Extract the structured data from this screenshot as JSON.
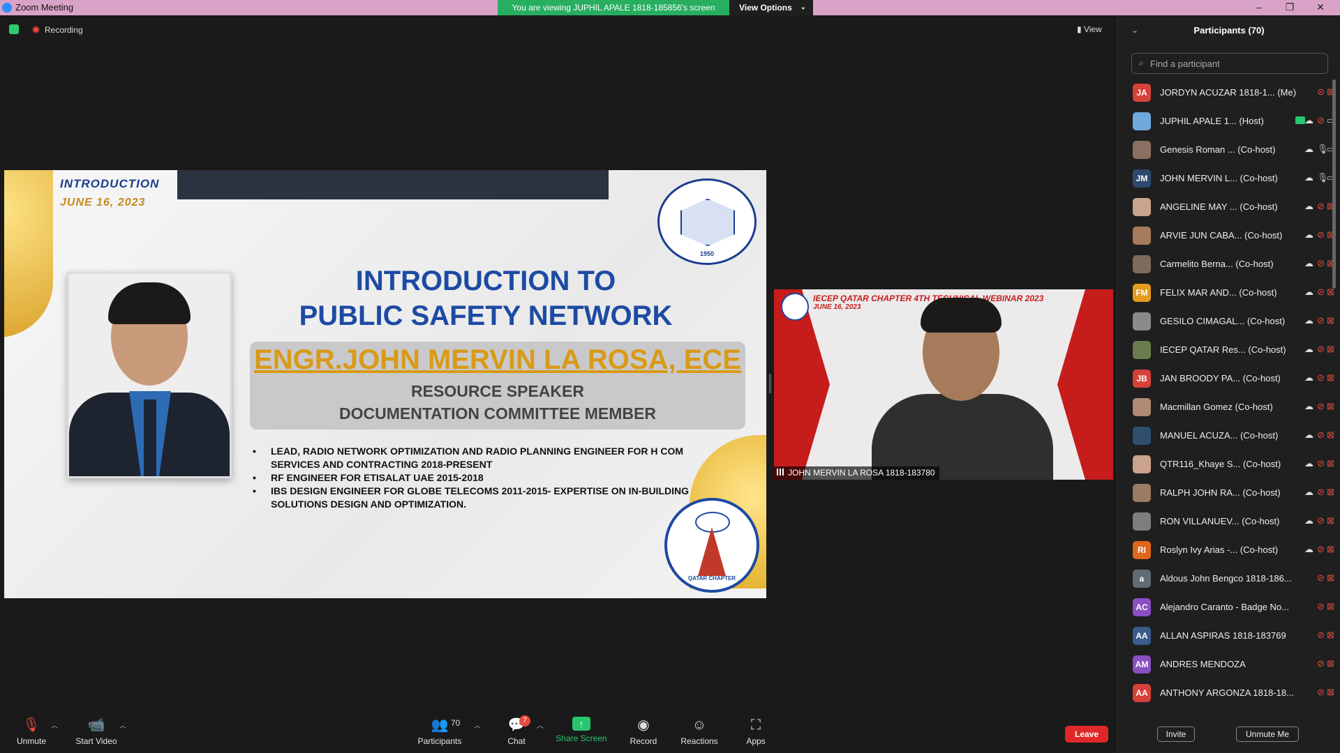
{
  "window": {
    "title": "Zoom Meeting",
    "viewing_banner": "You are viewing JUPHIL APALE 1818-185856's screen",
    "view_options": "View Options"
  },
  "meeting": {
    "recording_label": "Recording",
    "view_label": "View"
  },
  "slide": {
    "intro_label": "INTRODUCTION",
    "date_label": "JUNE 16, 2023",
    "title_line1": "INTRODUCTION TO",
    "title_line2": "PUBLIC SAFETY NETWORK",
    "speaker_name": "ENGR.JOHN MERVIN LA ROSA, ECE",
    "role_line1": "RESOURCE SPEAKER",
    "role_line2": "DOCUMENTATION COMMITTEE MEMBER",
    "bullets": [
      "LEAD, RADIO NETWORK OPTIMIZATION AND RADIO PLANNING ENGINEER FOR H COM SERVICES AND CONTRACTING 2018-PRESENT",
      "RF ENGINEER FOR ETISALAT UAE 2015-2018",
      "IBS DESIGN ENGINEER FOR GLOBE TELECOMS 2011-2015- EXPERTISE ON IN-BUILDING SOLUTIONS DESIGN AND OPTIMIZATION."
    ],
    "logo_top_text": "1950",
    "logo_bottom_caption": "QATAR CHAPTER"
  },
  "video": {
    "banner": "IECEP QATAR CHAPTER 4TH TECHNICAL WEBINAR 2023",
    "banner_date": "JUNE 16, 2023",
    "name_tag": "JOHN MERVIN LA ROSA 1818-183780"
  },
  "toolbar": {
    "unmute": "Unmute",
    "start_video": "Start Video",
    "participants": "Participants",
    "participants_count": "70",
    "chat": "Chat",
    "chat_badge": "7",
    "share_screen": "Share Screen",
    "record": "Record",
    "reactions": "Reactions",
    "apps": "Apps",
    "leave": "Leave"
  },
  "panel": {
    "title": "Participants (70)",
    "search_placeholder": "Find a participant",
    "invite": "Invite",
    "unmute_me": "Unmute Me",
    "participants": [
      {
        "initials": "JA",
        "color": "#d6413a",
        "name": "JORDYN ACUZAR 1818-1...  (Me)",
        "cloud": false,
        "mic": "off",
        "cam": "off"
      },
      {
        "initials": "",
        "color": "#6fa8dc",
        "name": "JUPHIL APALE 1...  (Host)",
        "cloud": true,
        "host_badge": true,
        "mic": "off",
        "cam": "on"
      },
      {
        "initials": "",
        "color": "#8d6e63",
        "name": "Genesis Roman ...  (Co-host)",
        "cloud": true,
        "mic": "on",
        "cam": "on"
      },
      {
        "initials": "JM",
        "color": "#2c4a6e",
        "name": "JOHN MERVIN L...  (Co-host)",
        "cloud": true,
        "mic": "on",
        "cam": "on"
      },
      {
        "initials": "",
        "color": "#c9a58c",
        "name": "ANGELINE MAY ...  (Co-host)",
        "cloud": true,
        "mic": "off",
        "cam": "off"
      },
      {
        "initials": "",
        "color": "#a67b5b",
        "name": "ARVIE JUN CABA...  (Co-host)",
        "cloud": true,
        "mic": "off",
        "cam": "off"
      },
      {
        "initials": "",
        "color": "#7d6b5d",
        "name": "Carmelito Berna...  (Co-host)",
        "cloud": true,
        "mic": "off",
        "cam": "off"
      },
      {
        "initials": "FM",
        "color": "#e69b1e",
        "name": "FELIX MAR AND...  (Co-host)",
        "cloud": true,
        "mic": "off",
        "cam": "off"
      },
      {
        "initials": "",
        "color": "#8a8a8a",
        "name": "GESILO CIMAGAL...  (Co-host)",
        "cloud": true,
        "mic": "off",
        "cam": "off"
      },
      {
        "initials": "",
        "color": "#6b7d4f",
        "name": "IECEP QATAR Res...  (Co-host)",
        "cloud": true,
        "mic": "off",
        "cam": "off"
      },
      {
        "initials": "JB",
        "color": "#d6413a",
        "name": "JAN BROODY PA...  (Co-host)",
        "cloud": true,
        "mic": "off",
        "cam": "off"
      },
      {
        "initials": "",
        "color": "#b08a73",
        "name": "Macmillan Gomez (Co-host)",
        "cloud": true,
        "mic": "off",
        "cam": "off"
      },
      {
        "initials": "",
        "color": "#2f4f6f",
        "name": "MANUEL ACUZA...  (Co-host)",
        "cloud": true,
        "mic": "off",
        "cam": "off"
      },
      {
        "initials": "",
        "color": "#caa38a",
        "name": "QTR116_Khaye S...  (Co-host)",
        "cloud": true,
        "mic": "off",
        "cam": "off"
      },
      {
        "initials": "",
        "color": "#9c7b63",
        "name": "RALPH JOHN RA...  (Co-host)",
        "cloud": true,
        "mic": "off",
        "cam": "off"
      },
      {
        "initials": "",
        "color": "#7e7e7e",
        "name": "RON VILLANUEV...  (Co-host)",
        "cloud": true,
        "mic": "off",
        "cam": "off"
      },
      {
        "initials": "RI",
        "color": "#e0661b",
        "name": "Roslyn Ivy Arias -...  (Co-host)",
        "cloud": true,
        "mic": "off",
        "cam": "off"
      },
      {
        "initials": "a",
        "color": "#5f6b75",
        "name": "Aldous John Bengco 1818-186...",
        "cloud": false,
        "mic": "off",
        "cam": "off"
      },
      {
        "initials": "AC",
        "color": "#8a4fc3",
        "name": "Alejandro Caranto - Badge No...",
        "cloud": false,
        "mic": "off",
        "cam": "off"
      },
      {
        "initials": "AA",
        "color": "#3b5b8a",
        "name": "ALLAN ASPIRAS 1818-183769",
        "cloud": false,
        "mic": "off",
        "cam": "off"
      },
      {
        "initials": "AM",
        "color": "#8a4fc3",
        "name": "ANDRES MENDOZA",
        "cloud": false,
        "mic": "off",
        "cam": "off"
      },
      {
        "initials": "AA",
        "color": "#d6413a",
        "name": "ANTHONY ARGONZA 1818-18...",
        "cloud": false,
        "mic": "off",
        "cam": "off"
      }
    ]
  }
}
